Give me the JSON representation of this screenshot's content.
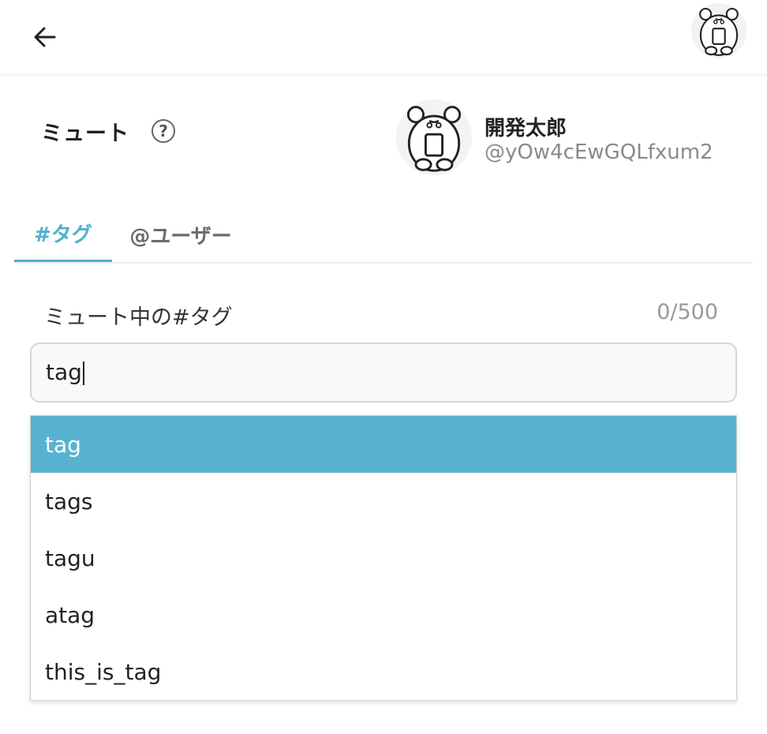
{
  "header": {
    "back_icon": "arrow-left-icon",
    "avatar_icon": "bear-avatar-icon"
  },
  "page": {
    "title": "ミュート",
    "help_icon": "question-circle-icon",
    "help_glyph": "?"
  },
  "profile": {
    "name": "開発太郎",
    "handle": "@yOw4cEwGQLfxum2"
  },
  "tabs": [
    {
      "label": "#タグ",
      "active": true
    },
    {
      "label": "@ユーザー",
      "active": false
    }
  ],
  "field": {
    "label": "ミュート中の#タグ",
    "count": "0/500",
    "value": "tag"
  },
  "suggestions": [
    {
      "label": "tag",
      "highlighted": true
    },
    {
      "label": "tags",
      "highlighted": false
    },
    {
      "label": "tagu",
      "highlighted": false
    },
    {
      "label": "atag",
      "highlighted": false
    },
    {
      "label": "this_is_tag",
      "highlighted": false
    }
  ],
  "colors": {
    "accent": "#4fb0cf",
    "highlight": "#58b3d1"
  }
}
